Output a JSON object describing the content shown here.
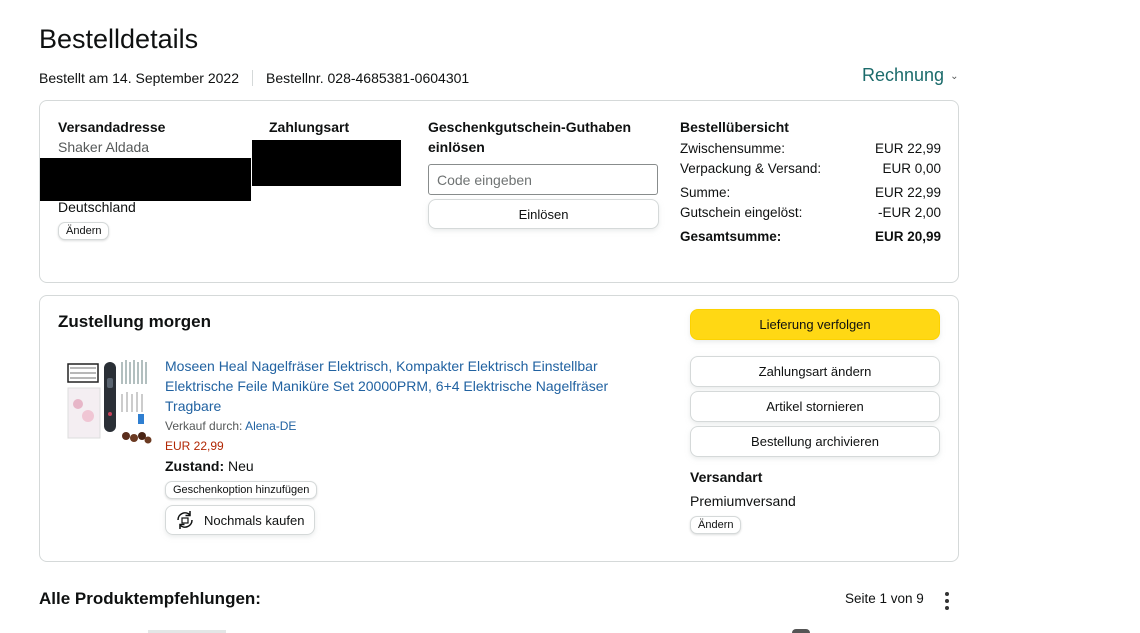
{
  "page": {
    "title": "Bestelldetails",
    "ordered_on": "Bestellt am 14. September 2022",
    "order_number": "Bestellnr. 028-4685381-0604301",
    "invoice_label": "Rechnung"
  },
  "summary": {
    "address_heading": "Versandadresse",
    "address_name": "Shaker Aldada",
    "address_country": "Deutschland",
    "address_change": "Ändern",
    "payment_heading": "Zahlungsart",
    "gift_heading": "Geschenkgutschein-Guthaben einlösen",
    "gift_placeholder": "Code eingeben",
    "gift_redeem": "Einlösen",
    "overview_heading": "Bestellübersicht",
    "rows": [
      {
        "label": "Zwischensumme:",
        "value": "EUR 22,99"
      },
      {
        "label": "Verpackung & Versand:",
        "value": "EUR 0,00"
      },
      {
        "label": "Summe:",
        "value": "EUR 22,99"
      },
      {
        "label": "Gutschein eingelöst:",
        "value": "-EUR 2,00"
      }
    ],
    "total_label": "Gesamtsumme:",
    "total_value": "EUR 20,99"
  },
  "shipment": {
    "status": "Zustellung morgen",
    "product_title": "Moseen Heal Nagelfräser Elektrisch, Kompakter Elektrisch Einstellbar Elektrische Feile Maniküre Set 20000PRM, 6+4 Elektrische Nagelfräser Tragbare",
    "seller_prefix": "Verkauf durch: ",
    "seller_name": "Alena-DE",
    "price": "EUR 22,99",
    "condition_label": "Zustand:",
    "condition_value": "Neu",
    "gift_option": "Geschenkoption hinzufügen",
    "buy_again": "Nochmals kaufen",
    "track": "Lieferung verfolgen",
    "change_payment": "Zahlungsart ändern",
    "cancel_items": "Artikel stornieren",
    "archive_order": "Bestellung archivieren",
    "ship_method_heading": "Versandart",
    "ship_method_value": "Premiumversand",
    "ship_method_change": "Ändern"
  },
  "recommendations": {
    "title": "Alle Produktempfehlungen:",
    "pager": "Seite 1 von 9"
  },
  "colors": {
    "primary_button": "#ffd814",
    "link": "#2162a1",
    "price": "#b12704",
    "invoice_link": "#1b6b6b"
  },
  "icons": [
    "chevron-down-icon",
    "buy-again-icon",
    "more-options-icon"
  ]
}
